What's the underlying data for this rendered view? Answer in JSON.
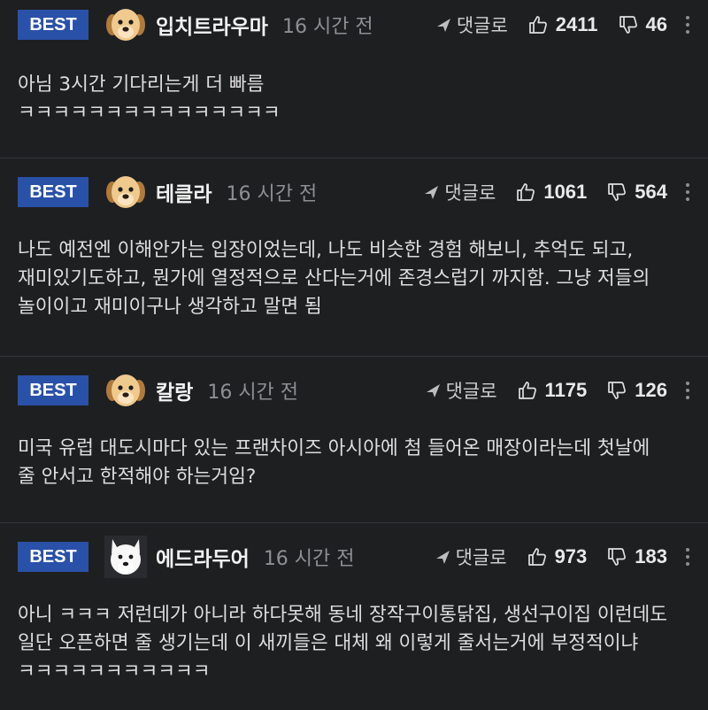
{
  "comments": [
    {
      "badge": "BEST",
      "avatar": "puppy-avatar",
      "nickname": "입치트라우마",
      "time": "16 시간 전",
      "reply_label": "댓글로",
      "likes": "2411",
      "dislikes": "46",
      "text": "아님 3시간 기다리는게 더 빠름\nㅋㅋㅋㅋㅋㅋㅋㅋㅋㅋㅋㅋㅋㅋㅋ"
    },
    {
      "badge": "BEST",
      "avatar": "puppy-avatar",
      "nickname": "테클라",
      "time": "16 시간 전",
      "reply_label": "댓글로",
      "likes": "1061",
      "dislikes": "564",
      "text": "나도 예전엔 이해안가는 입장이었는데, 나도 비슷한 경험 해보니, 추억도 되고, 재미있기도하고, 뭔가에 열정적으로 산다는거에 존경스럽기 까지함. 그냥 저들의 놀이이고 재미이구나 생각하고 말면 됨"
    },
    {
      "badge": "BEST",
      "avatar": "puppy-avatar",
      "nickname": "칼랑",
      "time": "16 시간 전",
      "reply_label": "댓글로",
      "likes": "1175",
      "dislikes": "126",
      "text": "미국 유럽 대도시마다 있는 프랜차이즈 아시아에 첨 들어온 매장이라는데 첫날에 줄 안서고 한적해야 하는거임?"
    },
    {
      "badge": "BEST",
      "avatar": "white-dog-avatar",
      "nickname": "에드라두어",
      "time": "16 시간 전",
      "reply_label": "댓글로",
      "likes": "973",
      "dislikes": "183",
      "text": "아니 ㅋㅋㅋ 저런데가 아니라 하다못해 동네 장작구이통닭집, 생선구이집 이런데도 일단 오픈하면 줄 생기는데 이 새끼들은 대체 왜 이렇게 줄서는거에 부정적이냐 ㅋㅋㅋㅋㅋㅋㅋㅋㅋㅋㅋ"
    }
  ],
  "colors": {
    "background": "#1e1f21",
    "badge": "#2a51a8",
    "divider": "#34363a"
  }
}
